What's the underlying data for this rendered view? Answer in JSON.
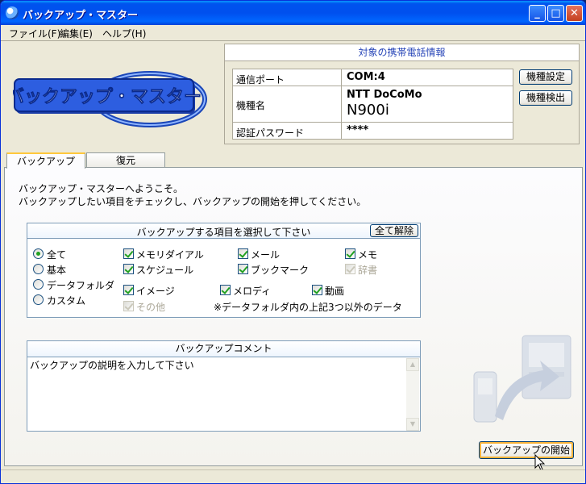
{
  "window": {
    "title": "バックアップ・マスター"
  },
  "menu": [
    "ファイル(F)",
    "編集(E)",
    "ヘルプ(H)"
  ],
  "logo": {
    "text": "バックアップ・マスター"
  },
  "device_info": {
    "header": "対象の携帯電話情報",
    "rows": [
      {
        "label": "通信ポート",
        "value": "COM:4"
      },
      {
        "label": "機種名",
        "value": "NTT DoCoMo",
        "value2": "N900i"
      },
      {
        "label": "認証パスワード",
        "value": "****"
      }
    ],
    "btn_settings": "機種設定",
    "btn_detect": "機種検出"
  },
  "tabs": [
    "バックアップ",
    "復元"
  ],
  "welcome": {
    "line1": "バックアップ・マスターへようこそ。",
    "line2": "バックアップしたい項目をチェックし、バックアップの開始を押してください。"
  },
  "items_group": {
    "title": "バックアップする項目を選択して下さい",
    "clear_all": "全て解除",
    "radios": [
      "全て",
      "基本",
      "データフォルダ",
      "カスタム"
    ],
    "selected_radio": "全て",
    "checks": {
      "memory_dial": "メモリダイアル",
      "mail": "メール",
      "memo": "メモ",
      "schedule": "スケジュール",
      "bookmark": "ブックマーク",
      "dictionary": "辞書",
      "image": "イメージ",
      "melody": "メロディ",
      "video": "動画",
      "other": "その他"
    },
    "note": "※データフォルダ内の上記3つ以外のデータ"
  },
  "comment": {
    "header": "バックアップコメント",
    "placeholder": "バックアップの説明を入力して下さい"
  },
  "start_button": "バックアップの開始",
  "colors": {
    "title_blue": "#0053ee",
    "check_green": "#21a121",
    "header_text": "#2846b8"
  }
}
